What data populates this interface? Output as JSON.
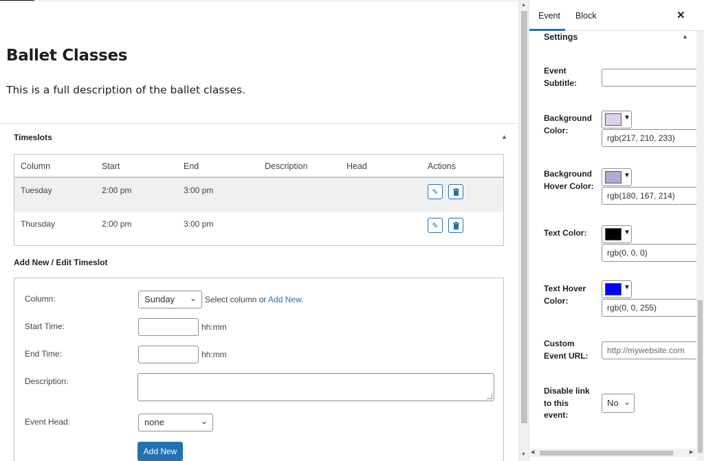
{
  "post": {
    "title": "Ballet Classes",
    "description": "This is a full description of the ballet classes."
  },
  "timeslots": {
    "title": "Timeslots",
    "columns": [
      "Column",
      "Start",
      "End",
      "Description",
      "Head",
      "Actions"
    ],
    "rows": [
      {
        "column": "Tuesday",
        "start": "2:00 pm",
        "end": "3:00 pm",
        "description": "",
        "head": ""
      },
      {
        "column": "Thursday",
        "start": "2:00 pm",
        "end": "3:00 pm",
        "description": "",
        "head": ""
      }
    ]
  },
  "form": {
    "title": "Add New / Edit Timeslot",
    "column_label": "Column:",
    "column_value": "Sunday",
    "column_hint": "Select column or",
    "add_new_link": "Add New.",
    "start_label": "Start Time:",
    "start_hint": "hh:mm",
    "end_label": "End Time:",
    "end_hint": "hh:mm",
    "description_label": "Description:",
    "head_label": "Event Head:",
    "head_value": "none",
    "submit_label": "Add New"
  },
  "sidebar": {
    "tabs": [
      "Event",
      "Block"
    ],
    "active_tab": "Event",
    "section_title": "Settings",
    "event_subtitle_label": "Event Subtitle:",
    "event_subtitle_value": "",
    "bg_color_label": "Background Color:",
    "bg_color_value": "rgb(217, 210, 233)",
    "bg_color_hex": "#d9d2e9",
    "bg_hover_label": "Background Hover Color:",
    "bg_hover_value": "rgb(180, 167, 214)",
    "bg_hover_hex": "#b4a7d6",
    "text_color_label": "Text Color:",
    "text_color_value": "rgb(0, 0, 0)",
    "text_color_hex": "#000000",
    "text_hover_label": "Text Hover Color:",
    "text_hover_value": "rgb(0, 0, 255)",
    "text_hover_hex": "#0000ff",
    "custom_url_label": "Custom Event URL:",
    "custom_url_placeholder": "http://mywebsite.com",
    "disable_link_label": "Disable link to this event:",
    "disable_link_value": "No"
  },
  "colors": {
    "accent": "#2271b1",
    "border": "#c3c4c7",
    "row_alt": "#f0f0f1"
  }
}
